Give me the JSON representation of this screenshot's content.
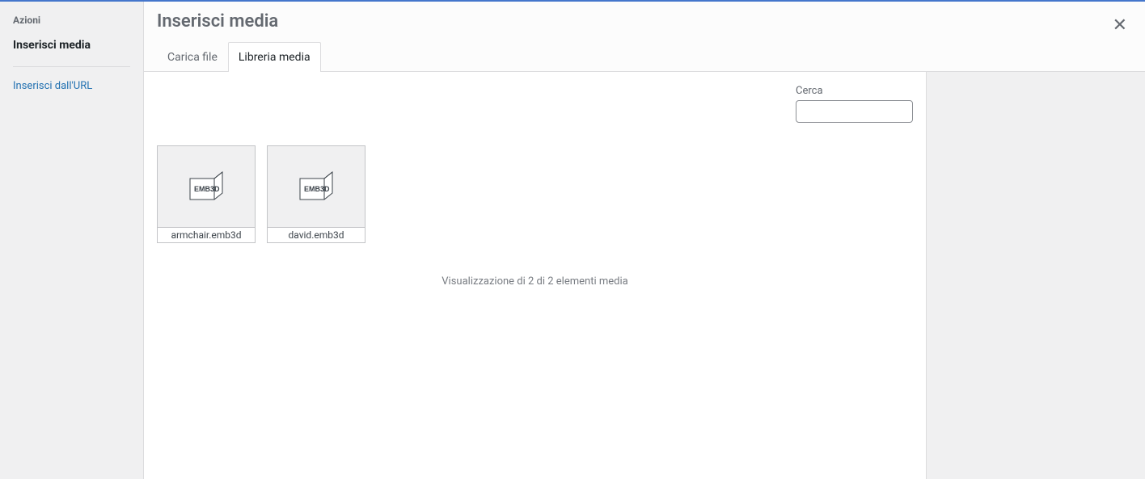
{
  "sidebar": {
    "heading": "Azioni",
    "items": [
      {
        "label": "Inserisci media",
        "active": true
      }
    ],
    "links": [
      {
        "label": "Inserisci dall'URL"
      }
    ]
  },
  "header": {
    "title": "Inserisci media"
  },
  "tabs": [
    {
      "label": "Carica file",
      "active": false
    },
    {
      "label": "Libreria media",
      "active": true
    }
  ],
  "search": {
    "label": "Cerca",
    "value": ""
  },
  "media_items": [
    {
      "filename": "armchair.emb3d",
      "icon_label": "EMB3D"
    },
    {
      "filename": "david.emb3d",
      "icon_label": "EMB3D"
    }
  ],
  "status_text": "Visualizzazione di 2 di 2 elementi media"
}
